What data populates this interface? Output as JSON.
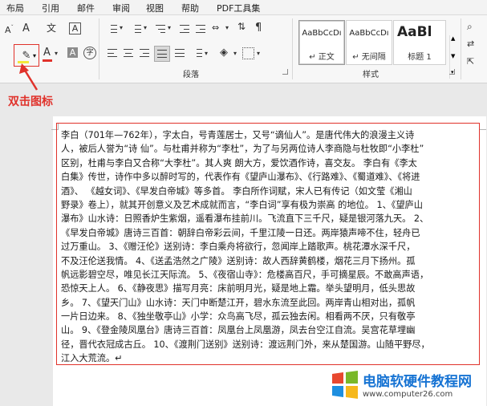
{
  "menu": {
    "items": [
      "布局",
      "引用",
      "邮件",
      "审阅",
      "视图",
      "帮助",
      "PDF工具集"
    ]
  },
  "ribbon": {
    "font_group": {
      "clear_format_glyph": "A",
      "phonetic_glyph": "文",
      "char_border_glyph": "A",
      "highlight_glyph": "✎",
      "font_color_glyph": "A",
      "char_shading_glyph": "A",
      "enclose_glyph": "字",
      "highlight_bar_color": "#f3e93b",
      "font_color_bar_color": "#e0322b"
    },
    "paragraph_group": {
      "label": "段落"
    },
    "styles_group": {
      "label": "样式",
      "styles": [
        {
          "preview": "AaBbCcDı",
          "name": "↵ 正文"
        },
        {
          "preview": "AaBbCcDı",
          "name": "↵ 无间隔"
        },
        {
          "preview": "AaBl",
          "name": "标题 1"
        }
      ]
    }
  },
  "annotation": {
    "text": "双击图标",
    "color": "#e0322b"
  },
  "document": {
    "lines": [
      "李白（701年—762年），字太白，号青莲居士，又号“谪仙人”。是唐代伟大的浪漫主义诗",
      "人，被后人誉为“诗 仙”。与杜甫并称为“李杜”，为了与另两位诗人李商隐与杜牧即“小李杜”",
      "区别，杜甫与李白又合称“大李杜”。其人爽 朗大方，爱饮酒作诗，喜交友。 李白有《李太",
      "白集》传世，诗作中多以醉时写的，代表作有《望庐山瀑布》、《行路难》、《蜀道难》、《将进",
      "酒》、 《越女词》、《早发白帝城》等多首。 李白所作词赋，宋人已有传记（如文莹《湘山",
      "野录》卷上），就其开创意义及艺术成就而言，“李白词”享有极为崇高 的地位。 1、《望庐山",
      "瀑布》山水诗：日照香炉生紫烟，遥看瀑布挂前川。飞流直下三千尺，疑是银河落九天。 2、",
      "《早发白帝城》唐诗三百首：朝辞白帝彩云间，千里江陵一日还。两岸猿声啼不住，轻舟已",
      "过万重山。 3、《赠汪伦》送别诗：李白乘舟将欲行，忽闻岸上踏歌声。桃花潭水深千尺，",
      "不及汪伦送我情。 4、《送孟浩然之广陵》送别诗：故人西辞黄鹤楼，烟花三月下扬州。孤",
      "帆远影碧空尽，唯见长江天际流。 5、《夜宿山寺》：危楼高百尺，手可摘星辰。不敢高声语，",
      "恐惊天上人。 6、《静夜思》描写月亮：床前明月光，疑是地上霜。举头望明月，低头思故",
      "乡。 7、《望天门山》山水诗：天门中断楚江开，碧水东流至此回。两岸青山相对出，孤帆",
      "一片日边来。 8、《独坐敬亭山》小学：众鸟高飞尽，孤云独去闲。相看两不厌，只有敬亭",
      "山。 9、《登金陵凤凰台》唐诗三百首：凤凰台上凤凰游，凤去台空江自流。吴宫花草埋幽",
      "径，晋代衣冠成古丘。 10、《渡荆门送别》送别诗：渡远荆门外，来从楚国游。山随平野尽，",
      "江入大荒流。↵"
    ],
    "highlight_color": "#e0322b"
  },
  "watermark": {
    "title": "电脑软硬件教程网",
    "url": "www.computer26.com",
    "logo_colors": [
      "#e8482f",
      "#7ab829",
      "#1e8fe0",
      "#f6b81b"
    ]
  }
}
